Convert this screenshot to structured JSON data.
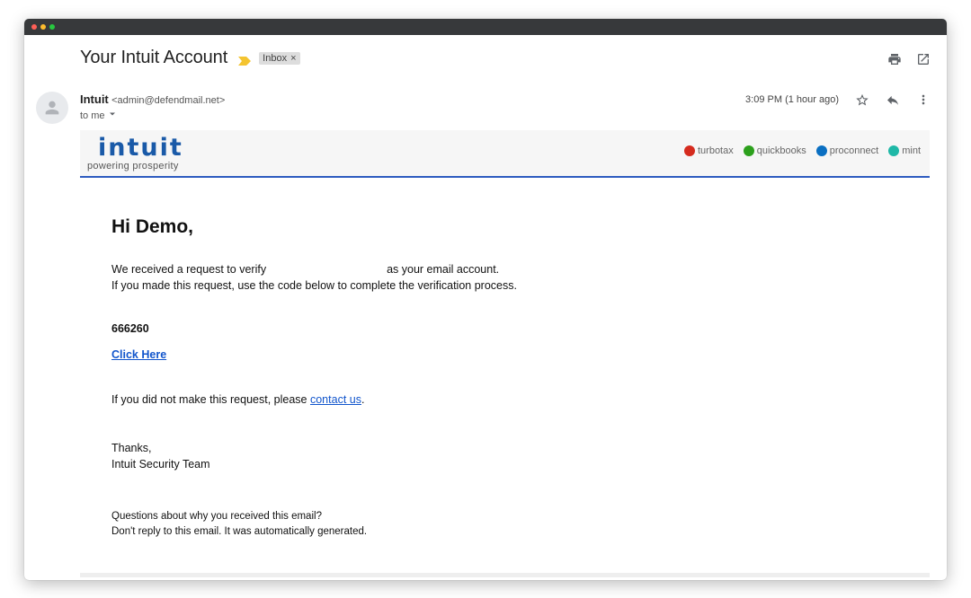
{
  "email": {
    "subject": "Your Intuit Account",
    "label_chip": "Inbox",
    "label_chip_close": "×",
    "sender_name": "Intuit",
    "sender_email": "<admin@defendmail.net>",
    "recipient_text": "to me",
    "time": "3:09 PM (1 hour ago)"
  },
  "brand": {
    "logo_text": "intuit",
    "tagline": "powering prosperity",
    "products": [
      {
        "name": "turbotax",
        "color": "#d52b1e"
      },
      {
        "name": "quickbooks",
        "color": "#2ca01c"
      },
      {
        "name": "proconnect",
        "color": "#0a6fc2"
      },
      {
        "name": "mint",
        "color": "#1fb8a7"
      }
    ],
    "accent_color": "#2d5bbf"
  },
  "message": {
    "greeting": "Hi Demo,",
    "line1_a": "We received a request to verify",
    "line1_b": "as your email account.",
    "line2": "If you made this request, use the code below to complete the verification process.",
    "code": "666260",
    "click_here": "Click Here",
    "not_you_a": "If you did not make this request, please",
    "not_you_link": "contact us",
    "not_you_b": ".",
    "thanks": "Thanks,",
    "signature": "Intuit Security Team",
    "footer_q": "Questions about why you received this email?",
    "footer_note": "Don't reply to this email. It was automatically generated."
  },
  "icons": [
    "print-icon",
    "open-in-new-window-icon",
    "star-icon",
    "reply-icon",
    "more-vert-icon",
    "avatar-person-icon",
    "chevron-down-icon",
    "important-marker-icon"
  ]
}
